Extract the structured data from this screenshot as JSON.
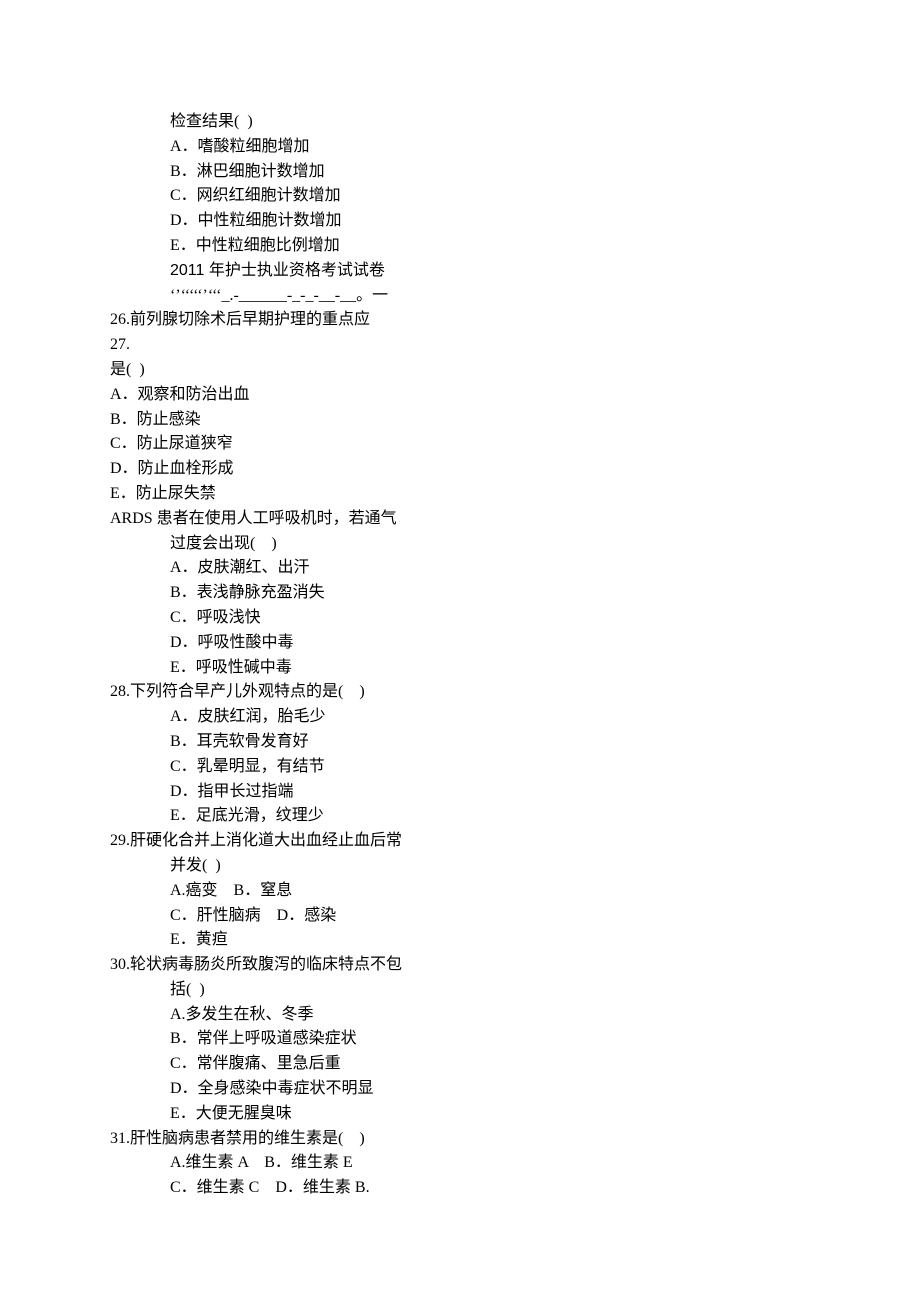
{
  "top_fragment": {
    "stem_tail": "检查结果(  )",
    "opts": [
      "A．嗜酸粒细胞增加",
      "B．淋巴细胞计数增加",
      "C．网织红细胞计数增加",
      "D．中性粒细胞计数增加",
      "E．中性粒细胞比例增加"
    ],
    "banner": "2011 年护士执业资格考试试卷",
    "decor": "‘’‘‘‘‘‘’‘‘‘_.-______-_-_-__-__。一"
  },
  "q26": {
    "line1": "26.前列腺切除术后早期护理的重点应",
    "line2": "27.",
    "line3": "是(  )",
    "opts": [
      "A．观察和防治出血",
      "B．防止感染",
      "C．防止尿道狭窄",
      "D．防止血栓形成",
      "E．防止尿失禁"
    ]
  },
  "ards": {
    "line1": "ARDS 患者在使用人工呼吸机时，若通气",
    "line2": "过度会出现(    )",
    "opts": [
      "A．皮肤潮红、出汗",
      "B．表浅静脉充盈消失",
      "C．呼吸浅快",
      "D．呼吸性酸中毒",
      "E．呼吸性碱中毒"
    ]
  },
  "q28": {
    "stem": "28.下列符合早产儿外观特点的是(    )",
    "opts": [
      "A．皮肤红润，胎毛少",
      "B．耳壳软骨发育好",
      "C．乳晕明显，有结节",
      "D．指甲长过指端",
      "E．足底光滑，纹理少"
    ]
  },
  "q29": {
    "line1": "29.肝硬化合并上消化道大出血经止血后常",
    "line2": "并发(  )",
    "row1": "A.癌变    B．窒息",
    "row2": "C．肝性脑病    D．感染",
    "row3": "E．黄疸"
  },
  "q30": {
    "line1": "30.轮状病毒肠炎所致腹泻的临床特点不包",
    "line2": "括(  )",
    "opts": [
      "A.多发生在秋、冬季",
      "B．常伴上呼吸道感染症状",
      "C．常伴腹痛、里急后重",
      "D．全身感染中毒症状不明显",
      "E．大便无腥臭味"
    ]
  },
  "q31": {
    "stem": "31.肝性脑病患者禁用的维生素是(    )",
    "row1": "A.维生素 A    B．维生素 E",
    "row2": "C．维生素 C    D．维生素 B."
  }
}
